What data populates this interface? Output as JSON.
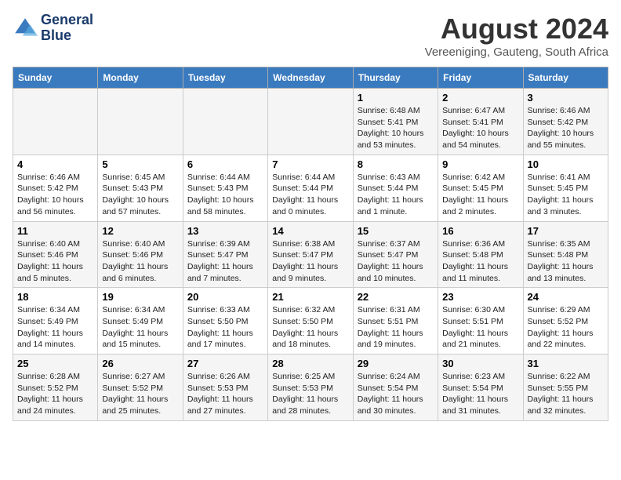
{
  "header": {
    "logo_line1": "General",
    "logo_line2": "Blue",
    "main_title": "August 2024",
    "subtitle": "Vereeniging, Gauteng, South Africa"
  },
  "days_of_week": [
    "Sunday",
    "Monday",
    "Tuesday",
    "Wednesday",
    "Thursday",
    "Friday",
    "Saturday"
  ],
  "weeks": [
    [
      {
        "date": "",
        "info": ""
      },
      {
        "date": "",
        "info": ""
      },
      {
        "date": "",
        "info": ""
      },
      {
        "date": "",
        "info": ""
      },
      {
        "date": "1",
        "info": "Sunrise: 6:48 AM\nSunset: 5:41 PM\nDaylight: 10 hours and 53 minutes."
      },
      {
        "date": "2",
        "info": "Sunrise: 6:47 AM\nSunset: 5:41 PM\nDaylight: 10 hours and 54 minutes."
      },
      {
        "date": "3",
        "info": "Sunrise: 6:46 AM\nSunset: 5:42 PM\nDaylight: 10 hours and 55 minutes."
      }
    ],
    [
      {
        "date": "4",
        "info": "Sunrise: 6:46 AM\nSunset: 5:42 PM\nDaylight: 10 hours and 56 minutes."
      },
      {
        "date": "5",
        "info": "Sunrise: 6:45 AM\nSunset: 5:43 PM\nDaylight: 10 hours and 57 minutes."
      },
      {
        "date": "6",
        "info": "Sunrise: 6:44 AM\nSunset: 5:43 PM\nDaylight: 10 hours and 58 minutes."
      },
      {
        "date": "7",
        "info": "Sunrise: 6:44 AM\nSunset: 5:44 PM\nDaylight: 11 hours and 0 minutes."
      },
      {
        "date": "8",
        "info": "Sunrise: 6:43 AM\nSunset: 5:44 PM\nDaylight: 11 hours and 1 minute."
      },
      {
        "date": "9",
        "info": "Sunrise: 6:42 AM\nSunset: 5:45 PM\nDaylight: 11 hours and 2 minutes."
      },
      {
        "date": "10",
        "info": "Sunrise: 6:41 AM\nSunset: 5:45 PM\nDaylight: 11 hours and 3 minutes."
      }
    ],
    [
      {
        "date": "11",
        "info": "Sunrise: 6:40 AM\nSunset: 5:46 PM\nDaylight: 11 hours and 5 minutes."
      },
      {
        "date": "12",
        "info": "Sunrise: 6:40 AM\nSunset: 5:46 PM\nDaylight: 11 hours and 6 minutes."
      },
      {
        "date": "13",
        "info": "Sunrise: 6:39 AM\nSunset: 5:47 PM\nDaylight: 11 hours and 7 minutes."
      },
      {
        "date": "14",
        "info": "Sunrise: 6:38 AM\nSunset: 5:47 PM\nDaylight: 11 hours and 9 minutes."
      },
      {
        "date": "15",
        "info": "Sunrise: 6:37 AM\nSunset: 5:47 PM\nDaylight: 11 hours and 10 minutes."
      },
      {
        "date": "16",
        "info": "Sunrise: 6:36 AM\nSunset: 5:48 PM\nDaylight: 11 hours and 11 minutes."
      },
      {
        "date": "17",
        "info": "Sunrise: 6:35 AM\nSunset: 5:48 PM\nDaylight: 11 hours and 13 minutes."
      }
    ],
    [
      {
        "date": "18",
        "info": "Sunrise: 6:34 AM\nSunset: 5:49 PM\nDaylight: 11 hours and 14 minutes."
      },
      {
        "date": "19",
        "info": "Sunrise: 6:34 AM\nSunset: 5:49 PM\nDaylight: 11 hours and 15 minutes."
      },
      {
        "date": "20",
        "info": "Sunrise: 6:33 AM\nSunset: 5:50 PM\nDaylight: 11 hours and 17 minutes."
      },
      {
        "date": "21",
        "info": "Sunrise: 6:32 AM\nSunset: 5:50 PM\nDaylight: 11 hours and 18 minutes."
      },
      {
        "date": "22",
        "info": "Sunrise: 6:31 AM\nSunset: 5:51 PM\nDaylight: 11 hours and 19 minutes."
      },
      {
        "date": "23",
        "info": "Sunrise: 6:30 AM\nSunset: 5:51 PM\nDaylight: 11 hours and 21 minutes."
      },
      {
        "date": "24",
        "info": "Sunrise: 6:29 AM\nSunset: 5:52 PM\nDaylight: 11 hours and 22 minutes."
      }
    ],
    [
      {
        "date": "25",
        "info": "Sunrise: 6:28 AM\nSunset: 5:52 PM\nDaylight: 11 hours and 24 minutes."
      },
      {
        "date": "26",
        "info": "Sunrise: 6:27 AM\nSunset: 5:52 PM\nDaylight: 11 hours and 25 minutes."
      },
      {
        "date": "27",
        "info": "Sunrise: 6:26 AM\nSunset: 5:53 PM\nDaylight: 11 hours and 27 minutes."
      },
      {
        "date": "28",
        "info": "Sunrise: 6:25 AM\nSunset: 5:53 PM\nDaylight: 11 hours and 28 minutes."
      },
      {
        "date": "29",
        "info": "Sunrise: 6:24 AM\nSunset: 5:54 PM\nDaylight: 11 hours and 30 minutes."
      },
      {
        "date": "30",
        "info": "Sunrise: 6:23 AM\nSunset: 5:54 PM\nDaylight: 11 hours and 31 minutes."
      },
      {
        "date": "31",
        "info": "Sunrise: 6:22 AM\nSunset: 5:55 PM\nDaylight: 11 hours and 32 minutes."
      }
    ]
  ]
}
